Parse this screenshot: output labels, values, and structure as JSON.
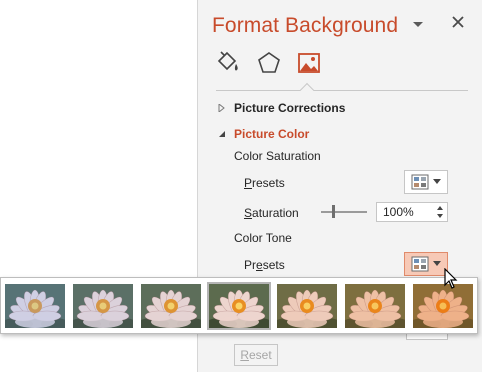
{
  "pane": {
    "title": "Format Background",
    "categories": [
      "fill-icon",
      "effects-pentagon-icon",
      "picture-icon"
    ],
    "active_category": "picture-icon"
  },
  "sections": {
    "picture_corrections": "Picture Corrections",
    "picture_color": "Picture Color"
  },
  "color_saturation": {
    "heading": "Color Saturation",
    "presets_label": "Presets",
    "presets_accel": "P",
    "presets_rest": "resets",
    "saturation_label": "Saturation",
    "saturation_accel": "S",
    "saturation_rest": "aturation",
    "saturation_value": "100%",
    "saturation_level": 1.0
  },
  "color_tone": {
    "heading": "Color Tone",
    "presets_label": "Presets",
    "presets_pre": "Pr",
    "presets_accel": "e",
    "presets_post": "sets"
  },
  "gallery": {
    "thumbnail_count": 7,
    "selected_index": 3,
    "tones": [
      "cool-blue",
      "cooler",
      "slightly-cool",
      "original",
      "slightly-warm",
      "warm",
      "warmest"
    ]
  },
  "reset": {
    "label": "Reset",
    "accel": "R",
    "rest": "eset"
  },
  "colors": {
    "accent": "#c84b2b",
    "pane_bg": "#f3f3f3",
    "hot_button": "#f7c9b6"
  }
}
